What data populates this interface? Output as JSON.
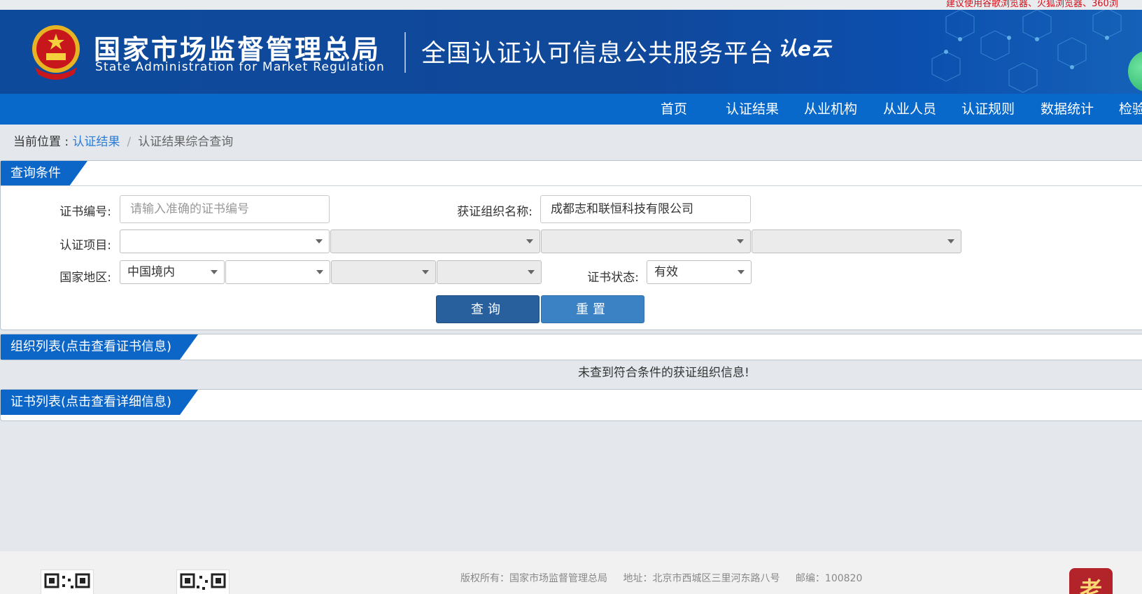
{
  "top_tip": "建议使用谷歌浏览器、火狐浏览器、360浏",
  "header": {
    "org_name_cn": "国家市场监督管理总局",
    "org_name_en": "State Administration  for  Market Regulation",
    "platform_title": "全国认证认可信息公共服务平台",
    "cloud_logo": "认e云"
  },
  "nav": [
    "首页",
    "认证结果",
    "从业机构",
    "从业人员",
    "认证规则",
    "数据统计",
    "检验"
  ],
  "breadcrumb": {
    "prefix": "当前位置 :",
    "link": "认证结果",
    "separator": "/",
    "current": "认证结果综合查询"
  },
  "query_panel": {
    "title": "查询条件",
    "cert_no_label": "证书编号:",
    "cert_no_placeholder": "请输入准确的证书编号",
    "org_name_label": "获证组织名称:",
    "org_name_value": "成都志和联恒科技有限公司",
    "cert_project_label": "认证项目:",
    "region_label": "国家地区:",
    "region_value": "中国境内",
    "status_label": "证书状态:",
    "status_value": "有效",
    "query_button": "查询",
    "reset_button": "重置"
  },
  "org_list": {
    "title": "组织列表(点击查看证书信息)",
    "empty_message": "未查到符合条件的获证组织信息!"
  },
  "cert_list": {
    "title": "证书列表(点击查看详细信息)"
  },
  "footer": {
    "copyright": "版权所有：国家市场监督管理总局",
    "address": "地址：北京市西城区三里河东路八号",
    "postcode": "邮编：100820"
  },
  "colors": {
    "banner": "#0e4a9c",
    "nav": "#0869cb",
    "tag": "#0c66c8",
    "query_button": "#27609c",
    "reset_button": "#3a82c4"
  }
}
